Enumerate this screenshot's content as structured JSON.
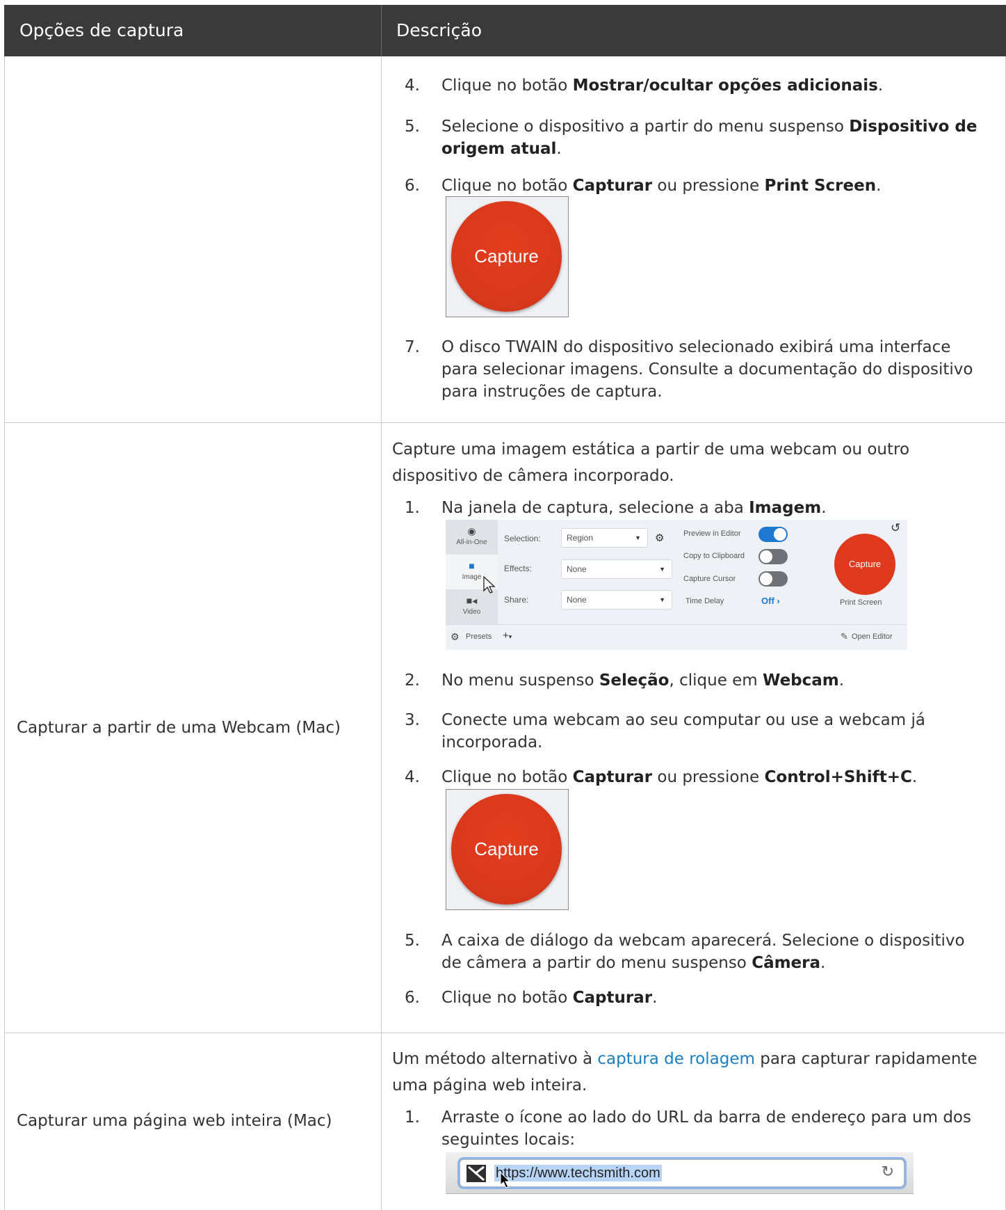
{
  "table": {
    "header": {
      "col1": "Opções de captura",
      "col2": "Descrição"
    }
  },
  "row1": {
    "option": "",
    "items": [
      {
        "num": "4.",
        "pre": "Clique no botão ",
        "b1": "Mostrar/ocultar opções adicionais",
        "post": "."
      },
      {
        "num": "5.",
        "pre": "Selecione o dispositivo a partir do menu suspenso ",
        "b1": "Dispositivo de origem atual",
        "post": "."
      },
      {
        "num": "6.",
        "pre": "Clique no botão ",
        "b1": "Capturar",
        "mid": " ou pressione ",
        "b2": "Print Screen",
        "post": "."
      },
      {
        "num": "7.",
        "text": "O disco TWAIN do dispositivo selecionado exibirá uma interface para selecionar imagens. Consulte a documentação do dispositivo para instruções de captura."
      }
    ],
    "capture_image_label": "Capture"
  },
  "row2": {
    "option": "Capturar a partir de uma Webcam (Mac)",
    "intro": "Capture uma imagem estática a partir de uma webcam ou outro dispositivo de câmera incorporado.",
    "items": [
      {
        "num": "1.",
        "pre": "Na janela de captura, selecione a aba ",
        "b1": "Imagem",
        "post": "."
      },
      {
        "num": "2.",
        "pre": "No menu suspenso ",
        "b1": "Seleção",
        "mid": ", clique em ",
        "b2": "Webcam",
        "post": "."
      },
      {
        "num": "3.",
        "text": "Conecte uma webcam ao seu computar ou use a webcam já incorporada."
      },
      {
        "num": "4.",
        "pre": "Clique no botão ",
        "b1": "Capturar",
        "mid": " ou pressione ",
        "b2": "Control+Shift+C",
        "post": "."
      },
      {
        "num": "5.",
        "pre": "A caixa de diálogo da webcam aparecerá. Selecione o dispositivo de câmera a partir do menu suspenso ",
        "b1": "Câmera",
        "post": "."
      },
      {
        "num": "6.",
        "pre": "Clique no botão ",
        "b1": "Capturar",
        "post": "."
      }
    ],
    "capture_image_label": "Capture",
    "capture_window": {
      "tabs": [
        "All-in-One",
        "Image",
        "Video"
      ],
      "selection_label": "Selection:",
      "selection_value": "Region",
      "effects_label": "Effects:",
      "effects_value": "None",
      "share_label": "Share:",
      "share_value": "None",
      "preview_label": "Preview in Editor",
      "copy_label": "Copy to Clipboard",
      "cursor_label": "Capture Cursor",
      "delay_label": "Time Delay",
      "delay_value": "Off",
      "capture_button": "Capture",
      "print_screen": "Print Screen",
      "presets": "Presets",
      "open_editor": "Open Editor"
    }
  },
  "row3": {
    "option": "Capturar uma página web inteira (Mac)",
    "intro_pre": "Um método alternativo à ",
    "intro_link": "captura de rolagem",
    "intro_post": " para capturar rapidamente uma página web inteira.",
    "items": [
      {
        "num": "1.",
        "text": "Arraste o ícone ao lado do URL da barra de endereço para um dos seguintes locais:"
      }
    ],
    "url": "https://www.techsmith.com"
  }
}
